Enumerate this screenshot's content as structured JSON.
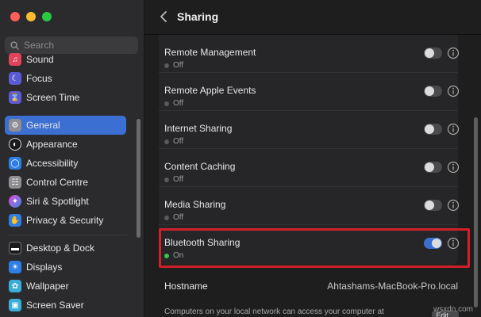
{
  "window": {
    "title": "Sharing",
    "traffic_lights": {
      "close": "#ff5f57",
      "minimize": "#febc2e",
      "zoom": "#28c840"
    }
  },
  "sidebar": {
    "search_placeholder": "Search",
    "items": [
      {
        "label": "Sound",
        "icon": "speaker-icon",
        "color": "#e0435a",
        "selected": false
      },
      {
        "label": "Focus",
        "icon": "moon-icon",
        "color": "#5b5bd6",
        "selected": false
      },
      {
        "label": "Screen Time",
        "icon": "hourglass-icon",
        "color": "#5b5bd6",
        "selected": false
      },
      {
        "label": "General",
        "icon": "gear-icon",
        "color": "#8e8e93",
        "selected": true
      },
      {
        "label": "Appearance",
        "icon": "appearance-icon",
        "color": "#1a1a1a",
        "selected": false
      },
      {
        "label": "Accessibility",
        "icon": "accessibility-icon",
        "color": "#2f7ee6",
        "selected": false
      },
      {
        "label": "Control Centre",
        "icon": "control-centre-icon",
        "color": "#8e8e93",
        "selected": false
      },
      {
        "label": "Siri & Spotlight",
        "icon": "siri-icon",
        "color": "#b54ad6",
        "selected": false
      },
      {
        "label": "Privacy & Security",
        "icon": "hand-icon",
        "color": "#2f7ee6",
        "selected": false
      },
      {
        "label": "Desktop & Dock",
        "icon": "dock-icon",
        "color": "#1a1a1a",
        "selected": false
      },
      {
        "label": "Displays",
        "icon": "display-icon",
        "color": "#2f7ee6",
        "selected": false
      },
      {
        "label": "Wallpaper",
        "icon": "wallpaper-icon",
        "color": "#3aaed8",
        "selected": false
      },
      {
        "label": "Screen Saver",
        "icon": "screensaver-icon",
        "color": "#3aaed8",
        "selected": false
      }
    ]
  },
  "services": [
    {
      "label": "Remote Management",
      "status": "Off",
      "on": false
    },
    {
      "label": "Remote Apple Events",
      "status": "Off",
      "on": false
    },
    {
      "label": "Internet Sharing",
      "status": "Off",
      "on": false
    },
    {
      "label": "Content Caching",
      "status": "Off",
      "on": false
    },
    {
      "label": "Media Sharing",
      "status": "Off",
      "on": false
    },
    {
      "label": "Bluetooth Sharing",
      "status": "On",
      "on": true,
      "highlighted": true
    }
  ],
  "hostname": {
    "label": "Hostname",
    "value": "Ahtashams-MacBook-Pro.local",
    "description": "Computers on your local network can access your computer at",
    "edit_label": "Edit..."
  },
  "watermark": "wsxdn.com",
  "colors": {
    "accent": "#3b6fd1",
    "highlight_border": "#d1202a",
    "status_on": "#3ac150"
  }
}
